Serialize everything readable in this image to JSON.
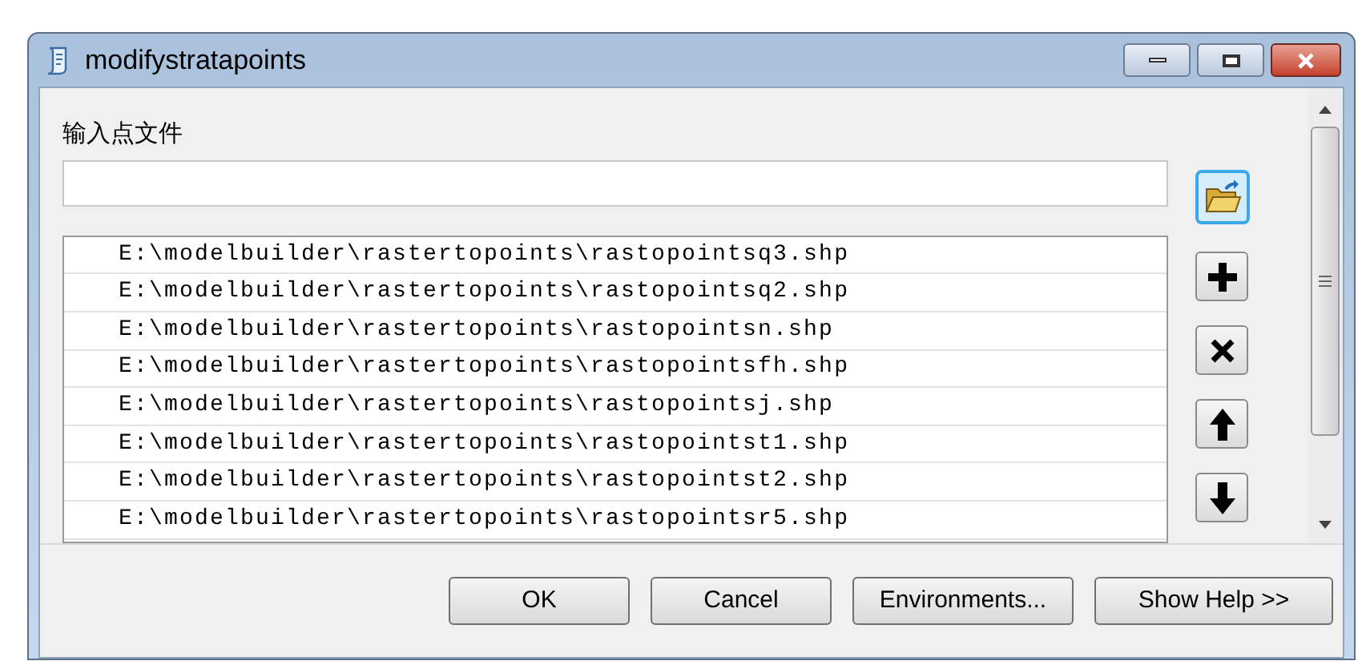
{
  "window": {
    "title": "modifystratapoints"
  },
  "input_label": "输入点文件",
  "file_list": [
    "E:\\modelbuilder\\rastertopoints\\rastopointsq3.shp",
    "E:\\modelbuilder\\rastertopoints\\rastopointsq2.shp",
    "E:\\modelbuilder\\rastertopoints\\rastopointsn.shp",
    "E:\\modelbuilder\\rastertopoints\\rastopointsfh.shp",
    "E:\\modelbuilder\\rastertopoints\\rastopointsj.shp",
    "E:\\modelbuilder\\rastertopoints\\rastopointst1.shp",
    "E:\\modelbuilder\\rastertopoints\\rastopointst2.shp",
    "E:\\modelbuilder\\rastertopoints\\rastopointsr5.shp"
  ],
  "buttons": [
    "OK",
    "Cancel",
    "Environments...",
    "Show Help >>"
  ]
}
